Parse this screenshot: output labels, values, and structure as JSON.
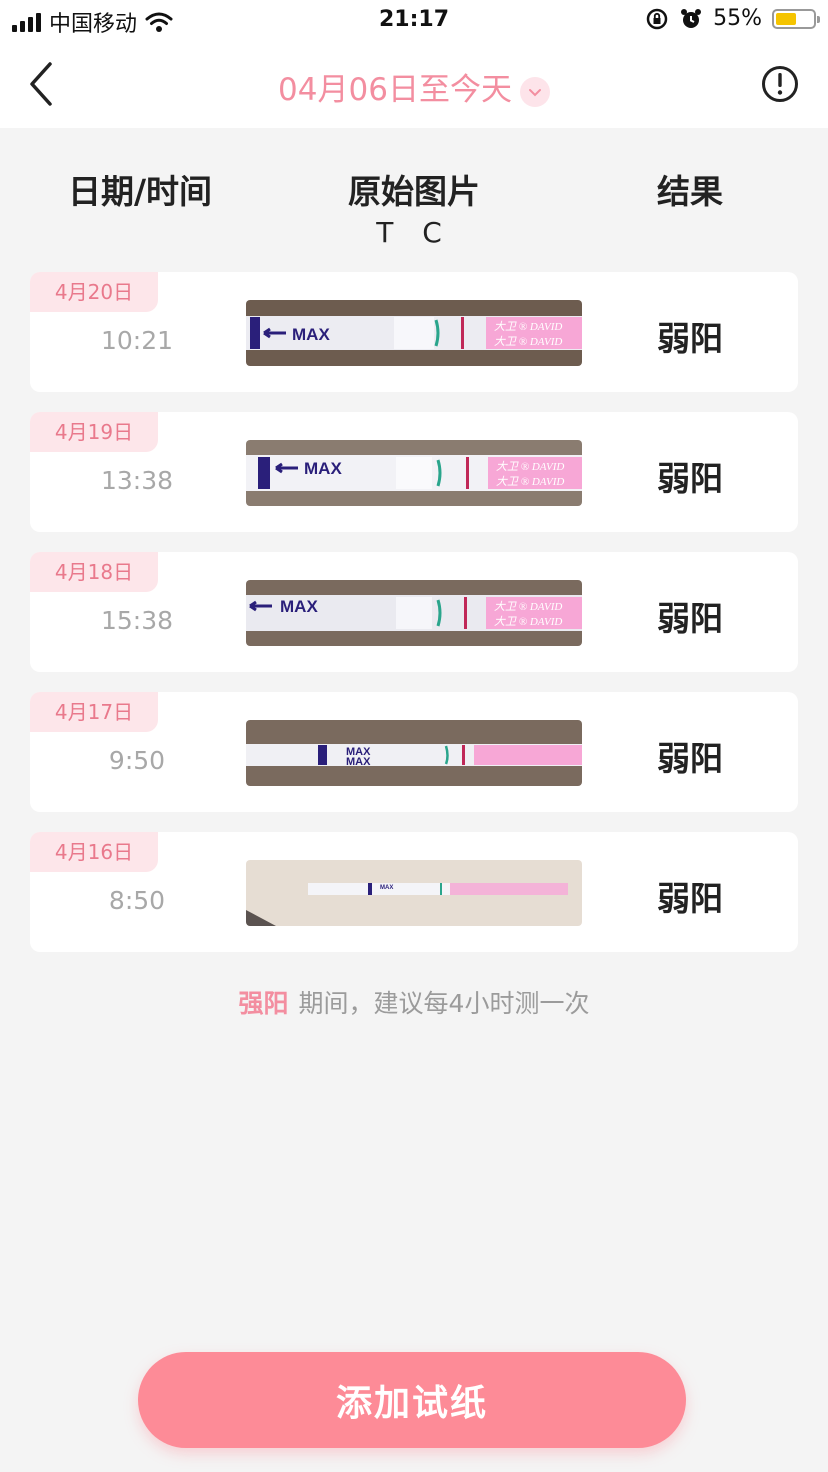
{
  "status_bar": {
    "carrier": "中国移动",
    "time": "21:17",
    "battery_percent": "55%",
    "battery_level": 0.55,
    "battery_color": "#f5c400"
  },
  "nav": {
    "title": "04月06日至今天",
    "back_icon": "chevron-left-icon",
    "info_icon": "exclamation-circle-icon",
    "accent_color": "#f38ea0"
  },
  "table_header": {
    "date_time": "日期/时间",
    "original_image": "原始图片",
    "tc": "T C",
    "result": "结果"
  },
  "records": [
    {
      "date": "4月20日",
      "time": "10:21",
      "result": "弱阳"
    },
    {
      "date": "4月19日",
      "time": "13:38",
      "result": "弱阳"
    },
    {
      "date": "4月18日",
      "time": "15:38",
      "result": "弱阳"
    },
    {
      "date": "4月17日",
      "time": "9:50",
      "result": "弱阳"
    },
    {
      "date": "4月16日",
      "time": "8:50",
      "result": "弱阳"
    }
  ],
  "tip": {
    "highlight": "强阳",
    "text": "期间，建议每4小时测一次"
  },
  "add_button": {
    "label": "添加试纸",
    "color": "#fd8b97"
  }
}
